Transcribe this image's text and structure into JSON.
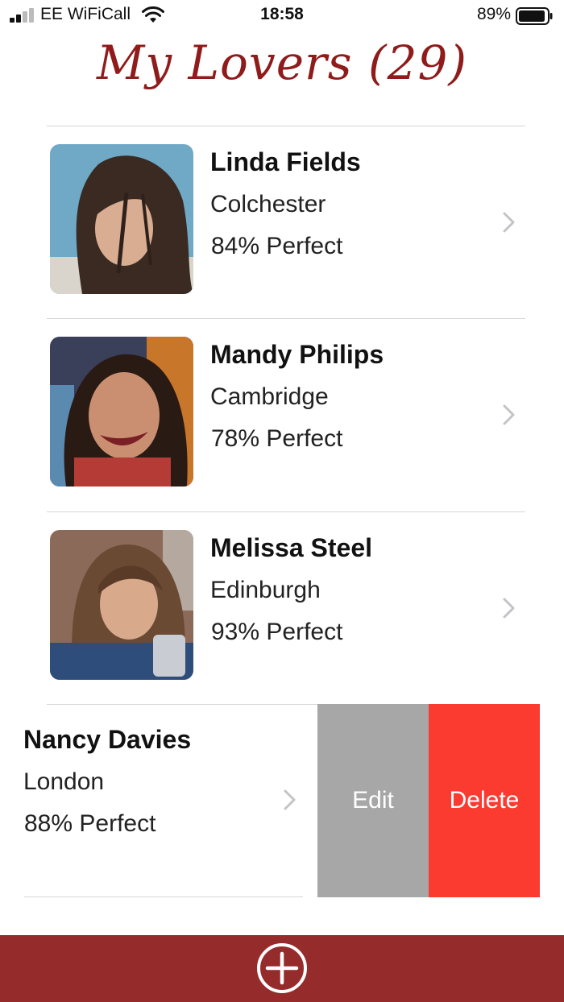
{
  "status": {
    "carrier": "EE WiFiCall",
    "time": "18:58",
    "battery": "89%"
  },
  "title": "My Lovers (29)",
  "lovers": [
    {
      "name": "Linda Fields",
      "city": "Colchester",
      "match": "84% Perfect"
    },
    {
      "name": "Mandy Philips",
      "city": "Cambridge",
      "match": "78% Perfect"
    },
    {
      "name": "Melissa Steel",
      "city": "Edinburgh",
      "match": "93% Perfect"
    }
  ],
  "swiped": {
    "name": "Nancy Davies",
    "city": "London",
    "match": "88% Perfect",
    "edit_label": "Edit",
    "delete_label": "Delete"
  },
  "colors": {
    "accent": "#962b2b",
    "title": "#8f1b1b",
    "delete": "#fb3b30",
    "edit": "#a7a7a7"
  },
  "icons": [
    "cellular-signal-icon",
    "wifi-icon",
    "battery-icon",
    "chevron-right-icon",
    "plus-circle-icon"
  ]
}
